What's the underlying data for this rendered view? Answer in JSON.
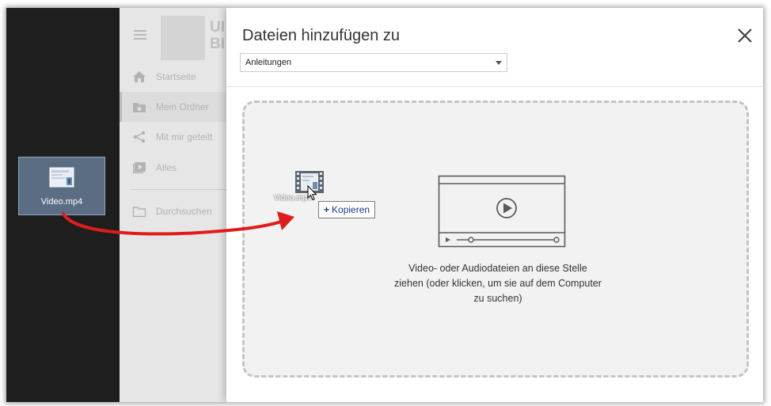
{
  "desktop": {
    "file_name": "Video.mp4",
    "icon": "video-file-icon"
  },
  "sidebar": {
    "logo_text_line1": "UI",
    "logo_text_line2": "BI",
    "items": [
      {
        "label": "Startseite",
        "icon": "home-icon"
      },
      {
        "label": "Mein Ordner",
        "icon": "folder-star-icon",
        "active": true
      },
      {
        "label": "Mit mir geteilt",
        "icon": "share-icon"
      },
      {
        "label": "Alles",
        "icon": "media-icon"
      },
      {
        "label": "Durchsuchen",
        "icon": "folder-icon"
      }
    ]
  },
  "dialog": {
    "title": "Dateien hinzufügen zu",
    "folder_select": {
      "value": "Anleitungen"
    },
    "dropzone": {
      "line1": "Video- oder Audiodateien an diese Stelle",
      "line2": "ziehen (oder klicken, um sie auf dem Computer",
      "line3": "zu suchen)"
    },
    "drag": {
      "ghost_name": "Video.mp4",
      "tooltip": "Kopieren",
      "tooltip_symbol": "+"
    }
  },
  "colors": {
    "arrow": "#e01b1b",
    "sidebar_bg": "#e6e6e6",
    "dropzone_border": "#c4c4c4"
  }
}
